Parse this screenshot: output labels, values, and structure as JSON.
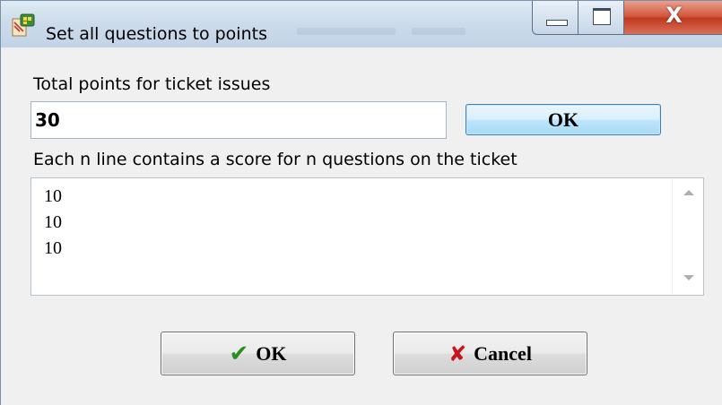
{
  "window": {
    "title": "Set all questions to points",
    "close_glyph": "X"
  },
  "form": {
    "total_points_label": "Total points for ticket issues",
    "total_points_value": "30",
    "ok_label": "OK",
    "scores_label": "Each n line contains a score for n questions on the ticket",
    "scores_lines": [
      "10",
      "10",
      "10"
    ]
  },
  "buttons": {
    "ok_label": "OK",
    "cancel_label": "Cancel",
    "ok_icon": "✔",
    "cancel_icon": "✘"
  },
  "colors": {
    "ok_icon": "#2a8f1e",
    "cancel_icon": "#c8141c",
    "close_button": "#c8452c"
  }
}
